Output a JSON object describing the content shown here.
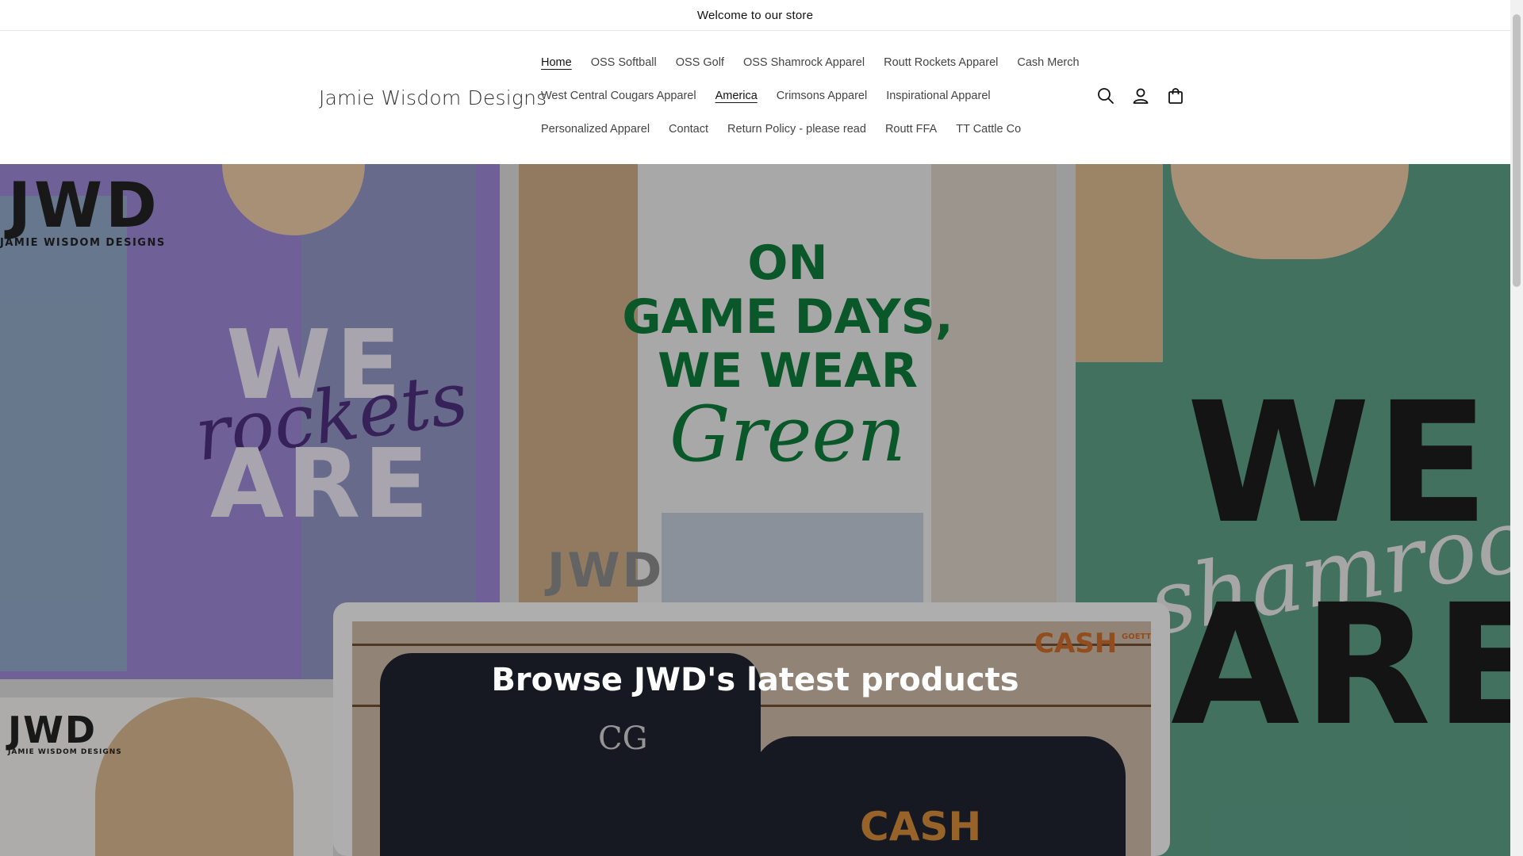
{
  "announcement": "Welcome to our store",
  "header": {
    "logo": "Jamie Wisdom Designs",
    "nav_row1": [
      "Home",
      "OSS Softball",
      "OSS Golf",
      "OSS Shamrock Apparel",
      "Routt Rockets Apparel",
      "Cash Merch"
    ],
    "nav_row2": [
      "West Central Cougars Apparel",
      "America",
      "Crimsons Apparel",
      "Inspirational Apparel"
    ],
    "nav_row3": [
      "Personalized Apparel",
      "Contact",
      "Return Policy - please read",
      "Routt FFA",
      "TT Cattle Co"
    ],
    "icons": [
      "search-icon",
      "account-icon",
      "cart-icon"
    ]
  },
  "hero": {
    "title": "Browse JWD's latest products",
    "tile1_text": [
      "WE",
      "rockets",
      "ARE"
    ],
    "tile2_text": [
      "ON",
      "GAME DAYS,",
      "WE WEAR",
      "Green"
    ],
    "tile3_text": [
      "WE",
      "shamrocks",
      "ARE"
    ],
    "brand_short": "JWD",
    "brand_long": "JAMIE WISDOM DESIGNS",
    "cash_logo": "CASH",
    "cash_logo_side": "GOETTEN",
    "monogram": "CG"
  },
  "colors": {
    "accent": "#121212",
    "green": "#0f7a3a",
    "purple": "#9a86d3",
    "teal": "#5c9d86"
  }
}
